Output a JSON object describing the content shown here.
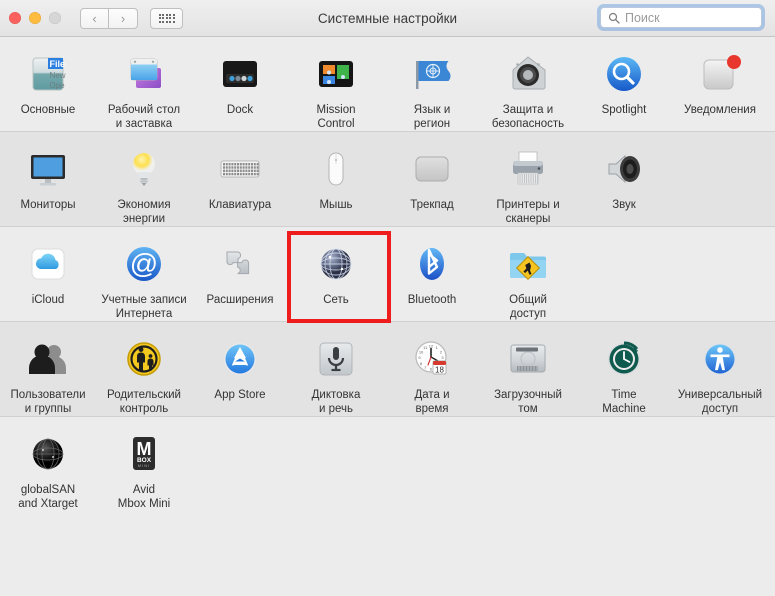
{
  "window": {
    "title": "Системные настройки",
    "traffic_lights": [
      "close-button",
      "minimize-button",
      "zoom-button"
    ],
    "colors": {
      "close": "#fc625d",
      "minimize": "#fdbc40",
      "zoom": "#d6d6d6",
      "window_background": "#ececec",
      "row_alt_background": "#e3e3e3",
      "highlight_box": "#ee1c1c",
      "search_focus_ring": "#76a5df"
    }
  },
  "toolbar": {
    "back_label": "‹",
    "forward_label": "›",
    "grid_button_name": "show-all-button"
  },
  "search": {
    "placeholder": "Поиск",
    "value": "",
    "icon": "search-icon",
    "focused": true
  },
  "rows": [
    {
      "index": 0,
      "shade": "a",
      "panes": [
        {
          "id": "general",
          "label": "Основные",
          "icon": "general-file-icon"
        },
        {
          "id": "desktop",
          "label": "Рабочий стол\nи заставка",
          "icon": "desktop-screensaver-icon"
        },
        {
          "id": "dock",
          "label": "Dock",
          "icon": "dock-icon"
        },
        {
          "id": "mission",
          "label": "Mission\nControl",
          "icon": "mission-control-icon"
        },
        {
          "id": "language",
          "label": "Язык и\nрегион",
          "icon": "flag-language-icon"
        },
        {
          "id": "security",
          "label": "Защита и\nбезопасность",
          "icon": "security-house-icon"
        },
        {
          "id": "spotlight",
          "label": "Spotlight",
          "icon": "spotlight-magnifier-icon"
        },
        {
          "id": "notifications",
          "label": "Уведомления",
          "icon": "notifications-badge-icon"
        }
      ]
    },
    {
      "index": 1,
      "shade": "b",
      "panes": [
        {
          "id": "displays",
          "label": "Мониторы",
          "icon": "display-monitor-icon"
        },
        {
          "id": "energy",
          "label": "Экономия\nэнергии",
          "icon": "lightbulb-icon"
        },
        {
          "id": "keyboard",
          "label": "Клавиатура",
          "icon": "keyboard-icon"
        },
        {
          "id": "mouse",
          "label": "Мышь",
          "icon": "mouse-icon"
        },
        {
          "id": "trackpad",
          "label": "Трекпад",
          "icon": "trackpad-icon"
        },
        {
          "id": "printers",
          "label": "Принтеры и\nсканеры",
          "icon": "printer-icon"
        },
        {
          "id": "sound",
          "label": "Звук",
          "icon": "speaker-icon"
        }
      ]
    },
    {
      "index": 2,
      "shade": "a",
      "panes": [
        {
          "id": "icloud",
          "label": "iCloud",
          "icon": "icloud-icon"
        },
        {
          "id": "accounts",
          "label": "Учетные записи\nИнтернета",
          "icon": "at-sign-icon"
        },
        {
          "id": "extensions",
          "label": "Расширения",
          "icon": "puzzle-piece-icon"
        },
        {
          "id": "network",
          "label": "Сеть",
          "icon": "network-globe-icon",
          "highlighted": true
        },
        {
          "id": "bluetooth",
          "label": "Bluetooth",
          "icon": "bluetooth-icon"
        },
        {
          "id": "sharing",
          "label": "Общий\nдоступ",
          "icon": "sharing-folder-icon"
        }
      ]
    },
    {
      "index": 3,
      "shade": "b",
      "panes": [
        {
          "id": "users",
          "label": "Пользователи\nи группы",
          "icon": "users-group-icon"
        },
        {
          "id": "parental",
          "label": "Родительский\nконтроль",
          "icon": "parental-control-icon"
        },
        {
          "id": "appstore",
          "label": "App Store",
          "icon": "app-store-icon"
        },
        {
          "id": "dictation",
          "label": "Диктовка\nи речь",
          "icon": "microphone-icon"
        },
        {
          "id": "datetime",
          "label": "Дата и\nвремя",
          "icon": "clock-calendar-icon"
        },
        {
          "id": "startupdisk",
          "label": "Загрузочный\nтом",
          "icon": "hard-disk-icon"
        },
        {
          "id": "timemachine",
          "label": "Time\nMachine",
          "icon": "time-machine-icon"
        },
        {
          "id": "accessibility",
          "label": "Универсальный\nдоступ",
          "icon": "accessibility-icon"
        }
      ]
    },
    {
      "index": 4,
      "shade": "a",
      "last": true,
      "panes": [
        {
          "id": "globalsan",
          "label": "globalSAN\nand Xtarget",
          "icon": "globalsan-globe-icon"
        },
        {
          "id": "avidmbox",
          "label": "Avid\nMbox Mini",
          "icon": "avid-mbox-icon"
        }
      ]
    }
  ]
}
